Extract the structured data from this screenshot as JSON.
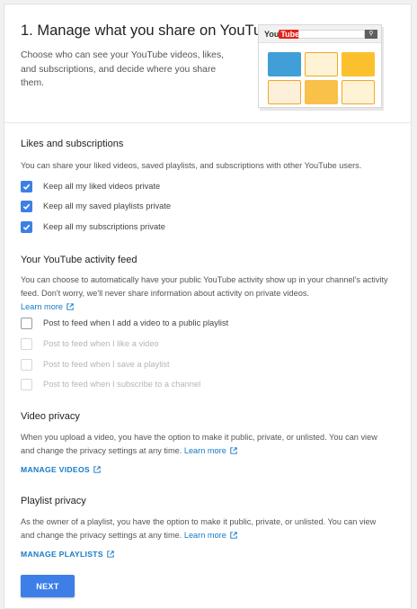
{
  "header": {
    "title": "1. Manage what you share on YouTube",
    "intro": "Choose who can see your YouTube videos, likes, and subscriptions, and decide where you share them."
  },
  "illustration": {
    "logo_you": "You",
    "logo_tube": "Tube",
    "search_icon": "search-icon",
    "thumb_colors": [
      "#3f9fd6",
      "#f6a623",
      "#fbc02d",
      "#f6a623",
      "#f9c04a",
      "#f6a623"
    ]
  },
  "likes": {
    "title": "Likes and subscriptions",
    "desc": "You can share your liked videos, saved playlists, and subscriptions with other YouTube users.",
    "options": [
      {
        "label": "Keep all my liked videos private",
        "checked": true
      },
      {
        "label": "Keep all my saved playlists private",
        "checked": true
      },
      {
        "label": "Keep all my subscriptions private",
        "checked": true
      }
    ]
  },
  "activity": {
    "title": "Your YouTube activity feed",
    "desc": "You can choose to automatically have your public YouTube activity show up in your channel's activity feed. Don't worry, we'll never share information about activity on private videos.",
    "learn_more": "Learn more",
    "options": [
      {
        "label": "Post to feed when I add a video to a public playlist",
        "checked": false,
        "disabled": false
      },
      {
        "label": "Post to feed when I like a video",
        "checked": false,
        "disabled": true
      },
      {
        "label": "Post to feed when I save a playlist",
        "checked": false,
        "disabled": true
      },
      {
        "label": "Post to feed when I subscribe to a channel",
        "checked": false,
        "disabled": true
      }
    ]
  },
  "video_privacy": {
    "title": "Video privacy",
    "desc": "When you upload a video, you have the option to make it public, private, or unlisted. You can view and change the privacy settings at any time.",
    "learn_more": "Learn more",
    "action": "MANAGE VIDEOS"
  },
  "playlist_privacy": {
    "title": "Playlist privacy",
    "desc": "As the owner of a playlist, you have the option to make it public, private, or unlisted. You can view and change the privacy settings at any time.",
    "learn_more": "Learn more",
    "action": "MANAGE PLAYLISTS"
  },
  "next_label": "NEXT",
  "colors": {
    "accent": "#3d7fe6",
    "link": "#167ac6",
    "youtube_red": "#e62117"
  }
}
